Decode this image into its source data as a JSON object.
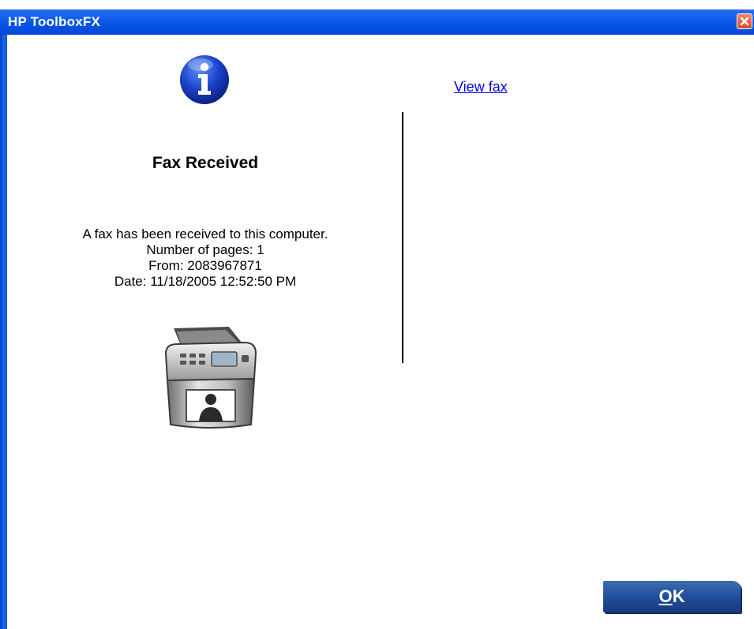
{
  "window": {
    "title": "HP ToolboxFX",
    "close_icon": "close-icon"
  },
  "dialog": {
    "icon": "info-icon",
    "heading": "Fax Received",
    "message_lines": [
      "A fax has been received to this computer.",
      "Number of pages: 1",
      "From: 2083967871",
      "Date: 11/18/2005 12:52:50 PM"
    ],
    "image": "printer-fax-icon",
    "link_label": "View fax",
    "ok_button": {
      "underlined_letter": "O",
      "rest": "K"
    }
  },
  "colors": {
    "titlebar": "#0a58e8",
    "link": "#0000ee",
    "ok_button": "#1f4c98",
    "close_button": "#d74b1f"
  }
}
